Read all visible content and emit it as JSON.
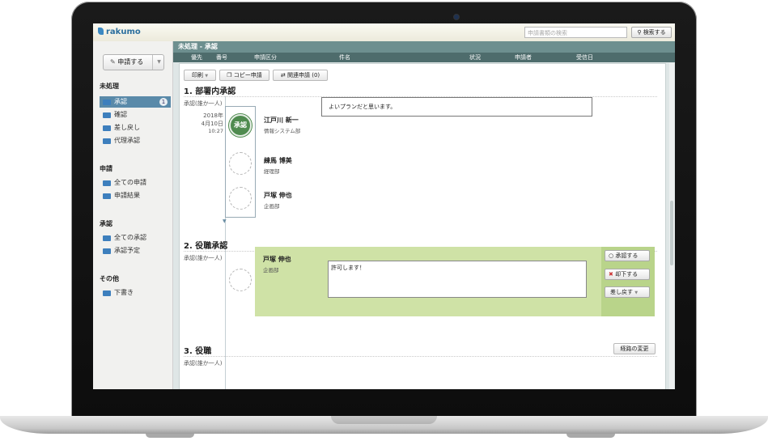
{
  "app": {
    "logo": "rakumo"
  },
  "search": {
    "placeholder": "申請書類の検索",
    "button": "検索する"
  },
  "sidebar": {
    "apply_button": "申請する",
    "sections": [
      {
        "title": "未処理",
        "items": [
          {
            "label": "承認",
            "count": "1"
          },
          {
            "label": "確認"
          },
          {
            "label": "差し戻し"
          },
          {
            "label": "代理承認"
          }
        ]
      },
      {
        "title": "申請",
        "items": [
          {
            "label": "全ての申請"
          },
          {
            "label": "申請結果"
          }
        ]
      },
      {
        "title": "承認",
        "items": [
          {
            "label": "全ての承認"
          },
          {
            "label": "承認予定"
          }
        ]
      },
      {
        "title": "その他",
        "items": [
          {
            "label": "下書き"
          }
        ]
      }
    ]
  },
  "main": {
    "title": "未処理 - 承認",
    "columns": [
      "優先",
      "番号",
      "申請区分",
      "件名",
      "状況",
      "申請者",
      "受信日"
    ],
    "toolbar": {
      "print": "印刷",
      "copy": "コピー申請",
      "related": "関連申請 (0)"
    },
    "steps": [
      {
        "heading": "1. 部署内承認",
        "rule": "承認(誰か一人)",
        "date": {
          "year": "2018年",
          "day": "4月10日",
          "time": "10:27"
        },
        "stamp": "承認",
        "approvers": [
          {
            "name": "江戸川 新一",
            "dept": "情報システム部",
            "comment": "よいプランだと思います。"
          },
          {
            "name": "練馬 博美",
            "dept": "経理部"
          },
          {
            "name": "戸塚 伸也",
            "dept": "企画部"
          }
        ]
      },
      {
        "heading": "2. 役職承認",
        "rule": "承認(誰か一人)",
        "approver": {
          "name": "戸塚 伸也",
          "dept": "企画部"
        },
        "comment_input": "許可します！",
        "actions": {
          "approve": "承認する",
          "reject": "却下する",
          "return": "差し戻す"
        }
      },
      {
        "heading": "3. 役職",
        "rule": "承認(誰か一人)",
        "route_button": "経路の変更"
      }
    ]
  },
  "colors": {
    "header": "#6d8f8f",
    "stamp": "#4f8b4f",
    "green_panel": "#cfe2a6"
  }
}
